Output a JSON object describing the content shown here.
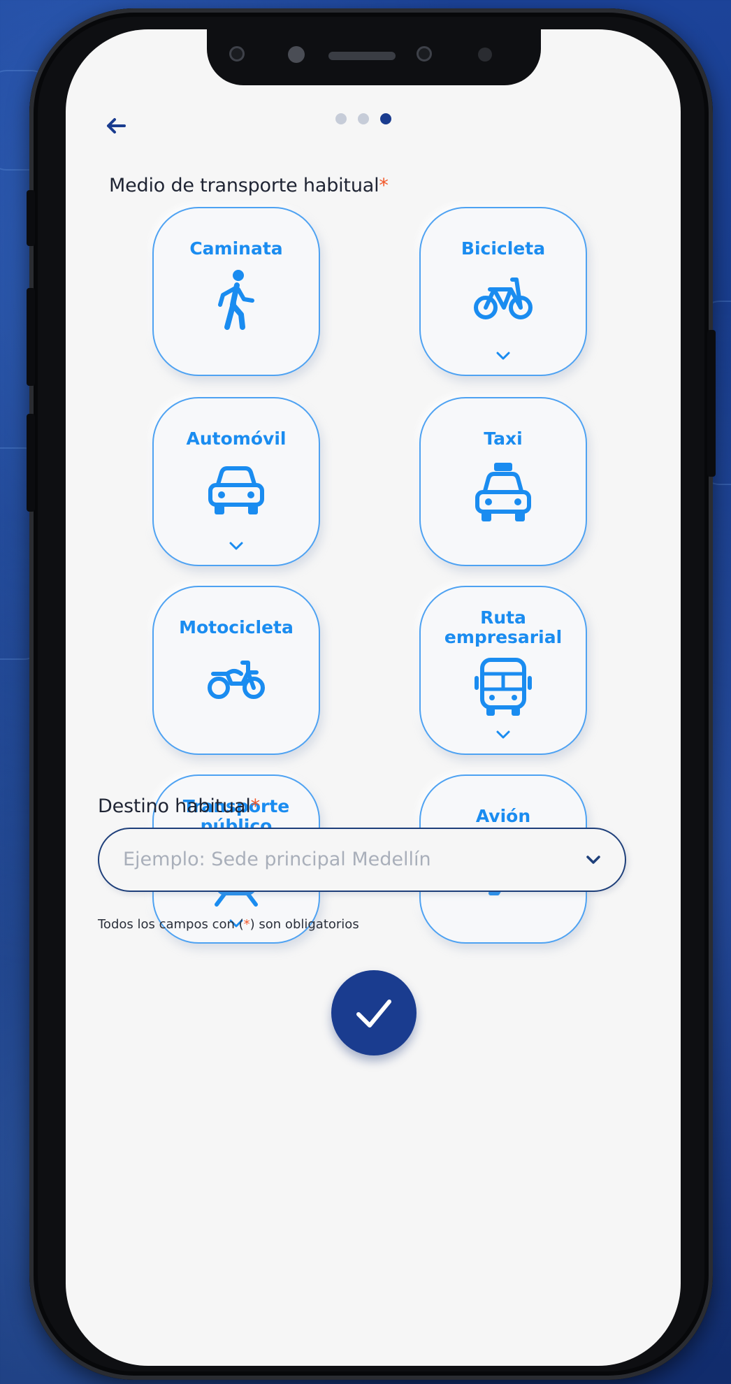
{
  "step_indicator": {
    "total": 3,
    "current": 3
  },
  "transport": {
    "label": "Medio de transporte habitual",
    "required_mark": "*",
    "options": [
      {
        "label": "Caminata",
        "icon": "walking-person-icon",
        "has_submenu": false
      },
      {
        "label": "Bicicleta",
        "icon": "bicycle-icon",
        "has_submenu": true
      },
      {
        "label": "Automóvil",
        "icon": "car-icon",
        "has_submenu": true
      },
      {
        "label": "Taxi",
        "icon": "taxi-icon",
        "has_submenu": false
      },
      {
        "label": "Motocicleta",
        "icon": "motorcycle-icon",
        "has_submenu": false
      },
      {
        "label": "Ruta empresarial",
        "icon": "bus-icon",
        "has_submenu": true
      },
      {
        "label": "Transporte público",
        "icon": "train-icon",
        "has_submenu": true
      },
      {
        "label": "Avión",
        "icon": "airplane-icon",
        "has_submenu": false
      }
    ]
  },
  "destination": {
    "label": "Destino habitual",
    "required_mark": "*",
    "placeholder": "Ejemplo: Sede principal Medellín"
  },
  "note": {
    "before": "Todos los campos con (",
    "mark": "*",
    "after": ") son obligatorios"
  },
  "colors": {
    "accent": "#1a8cf0",
    "primary": "#1a3c8f",
    "required": "#f2582a"
  }
}
